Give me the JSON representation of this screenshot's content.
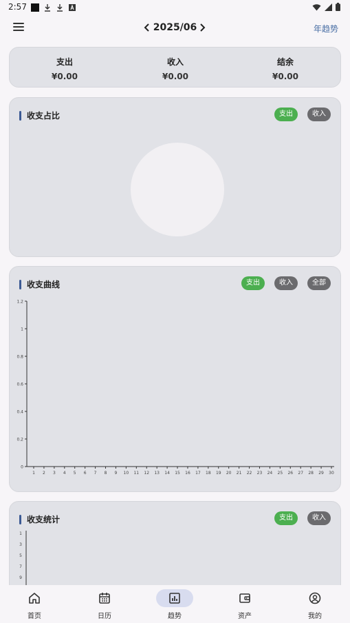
{
  "status_bar": {
    "time": "2:57"
  },
  "header": {
    "month": "2025/06",
    "year_trend": "年趋势"
  },
  "summary": {
    "expense_label": "支出",
    "expense_value": "¥0.00",
    "income_label": "收入",
    "income_value": "¥0.00",
    "balance_label": "结余",
    "balance_value": "¥0.00"
  },
  "ratio_card": {
    "title": "收支占比",
    "chips": [
      "支出",
      "收入"
    ],
    "selected": "支出"
  },
  "curve_card": {
    "title": "收支曲线",
    "chips": [
      "支出",
      "收入",
      "全部"
    ],
    "selected": "支出"
  },
  "stats_card": {
    "title": "收支统计",
    "chips": [
      "支出",
      "收入"
    ],
    "selected": "支出",
    "y_ticks": [
      "1",
      "3",
      "5",
      "7",
      "9"
    ]
  },
  "chart_data": {
    "type": "line",
    "title": "",
    "xlabel": "",
    "ylabel": "",
    "x": [
      1,
      2,
      3,
      4,
      5,
      6,
      7,
      8,
      9,
      10,
      11,
      12,
      13,
      14,
      15,
      16,
      17,
      18,
      19,
      20,
      21,
      22,
      23,
      24,
      25,
      26,
      27,
      28,
      29,
      30
    ],
    "y_ticks": [
      "0",
      "0.2",
      "0.4",
      "0.6",
      "0.8",
      "1",
      "1.2"
    ],
    "ylim": [
      0,
      1.2
    ],
    "series": []
  },
  "nav": [
    {
      "label": "首页",
      "icon": "home-icon"
    },
    {
      "label": "日历",
      "icon": "calendar-icon"
    },
    {
      "label": "趋势",
      "icon": "chart-icon",
      "active": true
    },
    {
      "label": "资产",
      "icon": "wallet-icon"
    },
    {
      "label": "我的",
      "icon": "profile-icon"
    }
  ],
  "colors": {
    "accent": "#4caf50",
    "chip_gray": "#6b6b6e",
    "card_bg": "#e1e2e7",
    "title_bar": "#3c5a94",
    "link": "#4a6fa5"
  }
}
